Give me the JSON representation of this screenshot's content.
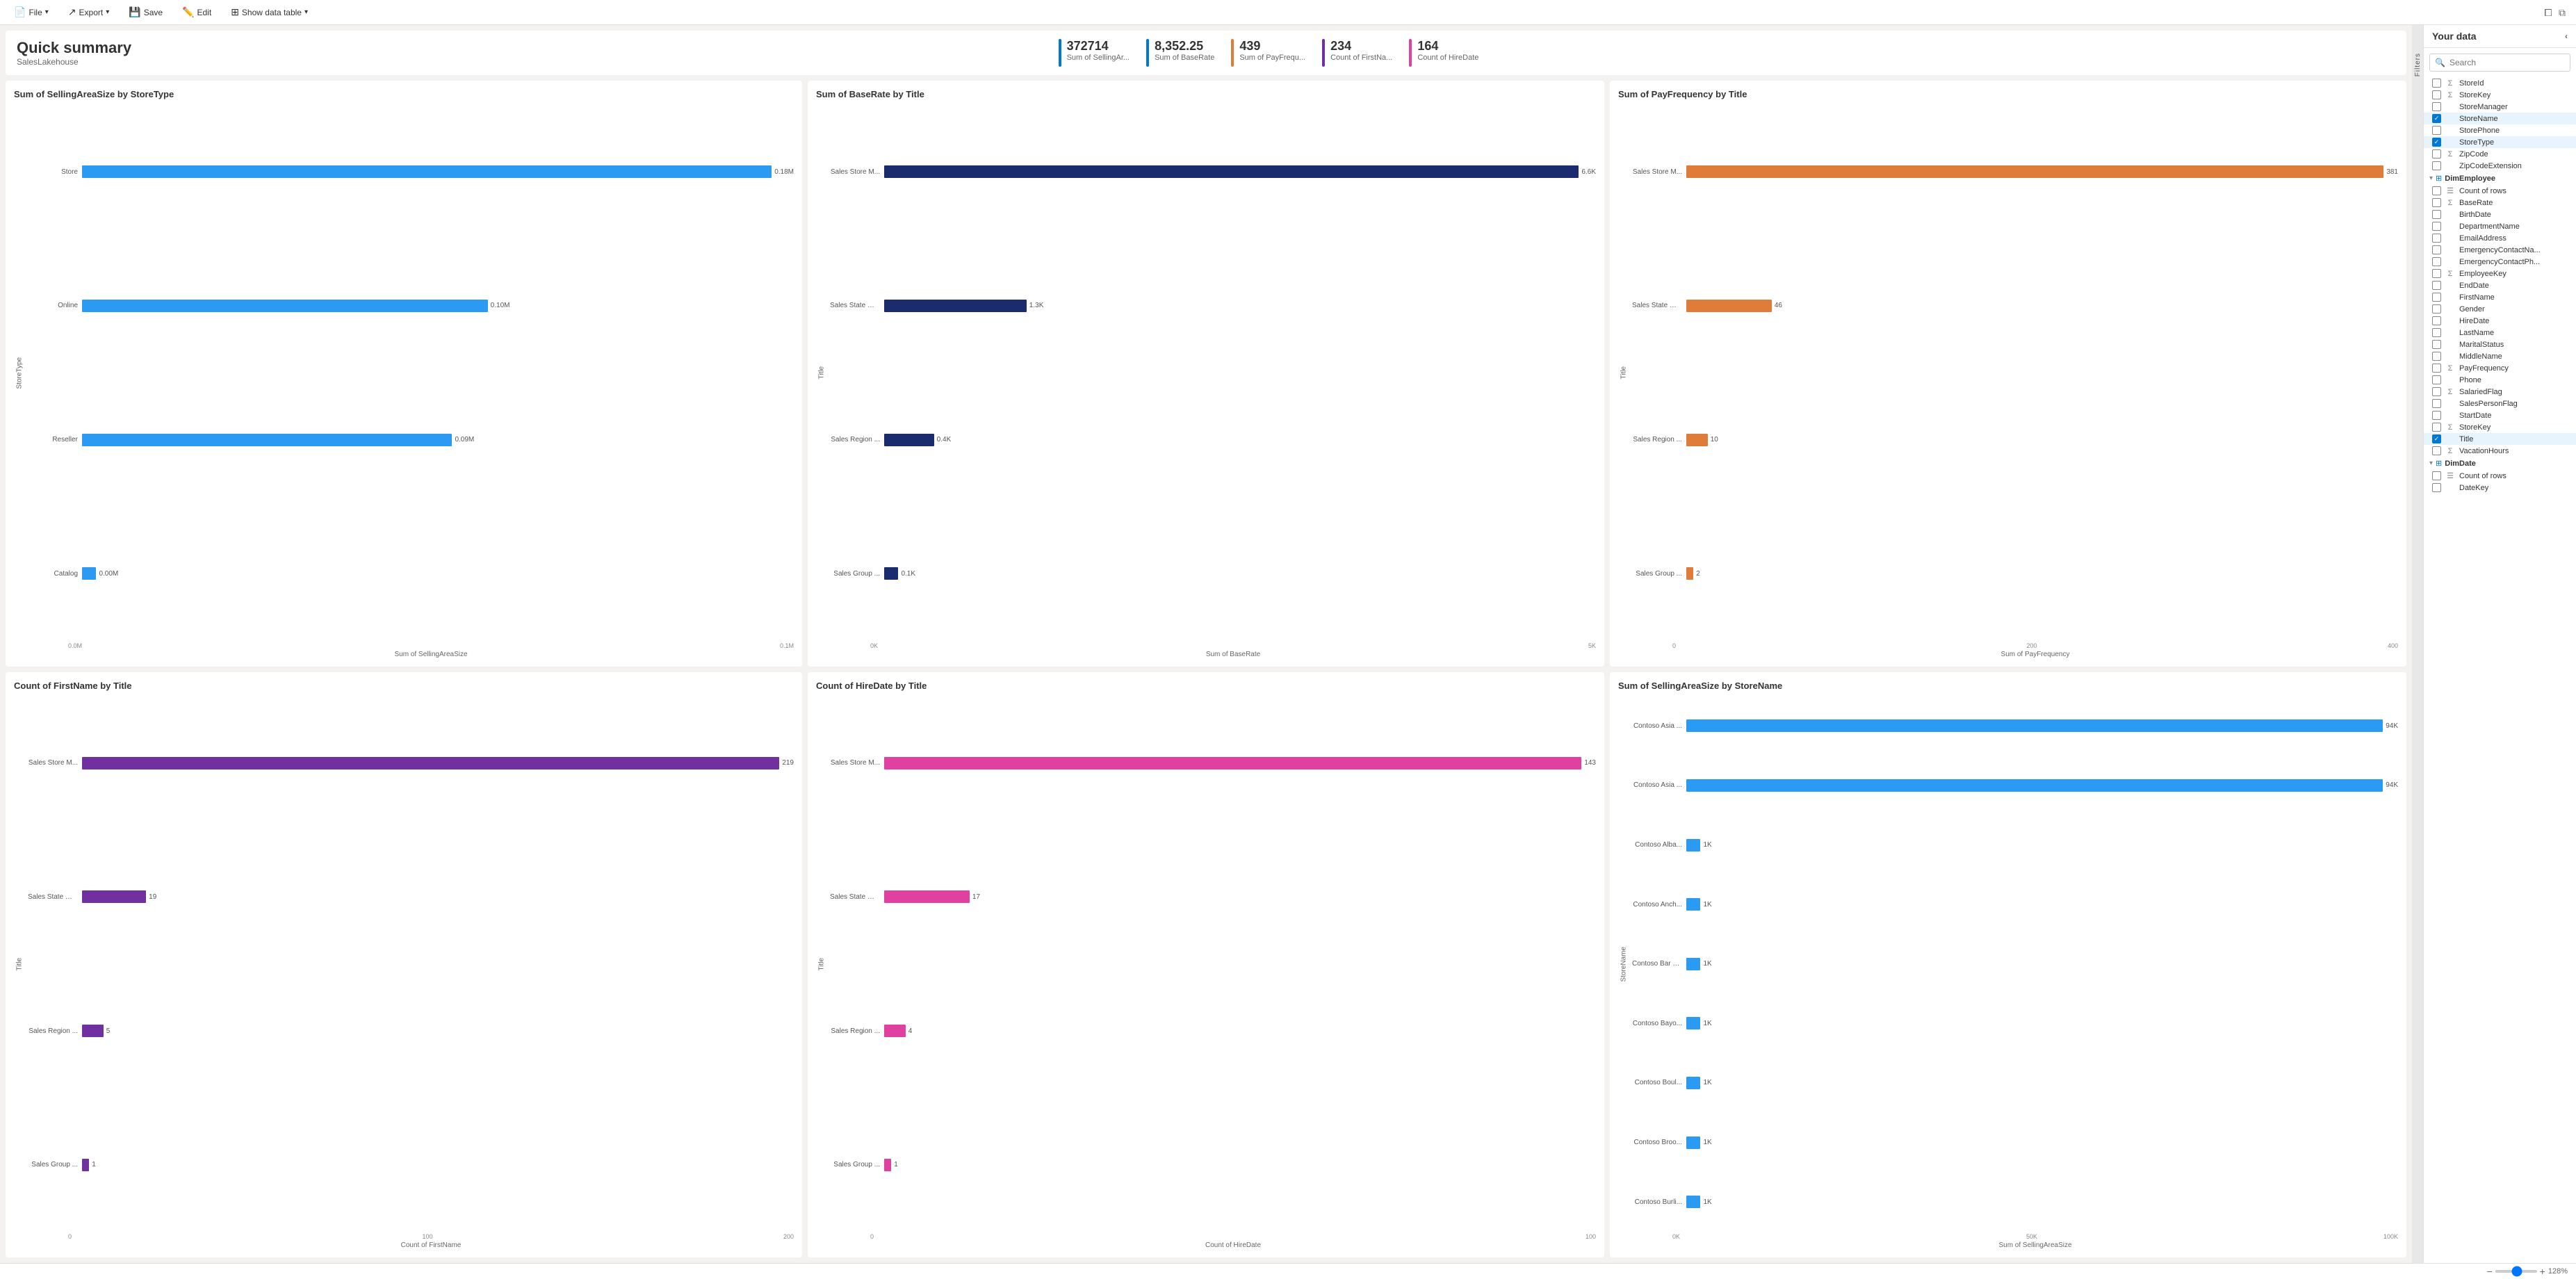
{
  "topbar": {
    "file_label": "File",
    "export_label": "Export",
    "save_label": "Save",
    "edit_label": "Edit",
    "show_data_table_label": "Show data table"
  },
  "header": {
    "title": "Quick summary",
    "subtitle": "SalesLakehouse",
    "kpis": [
      {
        "value": "372714",
        "label": "Sum of SellingAr...",
        "color": "#0078d4"
      },
      {
        "value": "8,352.25",
        "label": "Sum of BaseRate",
        "color": "#0078d4"
      },
      {
        "value": "439",
        "label": "Sum of PayFrequ...",
        "color": "#e07c39"
      },
      {
        "value": "234",
        "label": "Count of FirstNa...",
        "color": "#7030a0"
      },
      {
        "value": "164",
        "label": "Count of HireDate",
        "color": "#e040a0"
      }
    ]
  },
  "charts": [
    {
      "id": "chart1",
      "title": "Sum of SellingAreaSize by StoreType",
      "y_axis_label": "StoreType",
      "x_axis_label": "Sum of SellingAreaSize",
      "bar_color": "#2b9af3",
      "x_ticks": [
        "0.0M",
        "0.1M"
      ],
      "bars": [
        {
          "label": "Store",
          "value": "0.18M",
          "pct": 100
        },
        {
          "label": "Online",
          "value": "0.10M",
          "pct": 57
        },
        {
          "label": "Reseller",
          "value": "0.09M",
          "pct": 52
        },
        {
          "label": "Catalog",
          "value": "0.00M",
          "pct": 2
        }
      ]
    },
    {
      "id": "chart2",
      "title": "Sum of BaseRate by Title",
      "y_axis_label": "Title",
      "x_axis_label": "Sum of BaseRate",
      "bar_color": "#1a2c6e",
      "x_ticks": [
        "0K",
        "5K"
      ],
      "bars": [
        {
          "label": "Sales Store M...",
          "value": "6.6K",
          "pct": 100
        },
        {
          "label": "Sales State Ma...",
          "value": "1.3K",
          "pct": 20
        },
        {
          "label": "Sales Region ...",
          "value": "0.4K",
          "pct": 7
        },
        {
          "label": "Sales Group ...",
          "value": "0.1K",
          "pct": 2
        }
      ]
    },
    {
      "id": "chart3",
      "title": "Sum of PayFrequency by Title",
      "y_axis_label": "Title",
      "x_axis_label": "Sum of PayFrequency",
      "bar_color": "#e07c39",
      "x_ticks": [
        "0",
        "200",
        "400"
      ],
      "bars": [
        {
          "label": "Sales Store M...",
          "value": "381",
          "pct": 100
        },
        {
          "label": "Sales State Ma...",
          "value": "46",
          "pct": 12
        },
        {
          "label": "Sales Region ...",
          "value": "10",
          "pct": 3
        },
        {
          "label": "Sales Group ...",
          "value": "2",
          "pct": 1
        }
      ]
    },
    {
      "id": "chart4",
      "title": "Count of FirstName by Title",
      "y_axis_label": "Title",
      "x_axis_label": "Count of FirstName",
      "bar_color": "#7030a0",
      "x_ticks": [
        "0",
        "100",
        "200"
      ],
      "bars": [
        {
          "label": "Sales Store M...",
          "value": "219",
          "pct": 100
        },
        {
          "label": "Sales State Ma...",
          "value": "19",
          "pct": 9
        },
        {
          "label": "Sales Region ...",
          "value": "5",
          "pct": 3
        },
        {
          "label": "Sales Group ...",
          "value": "1",
          "pct": 1
        }
      ]
    },
    {
      "id": "chart5",
      "title": "Count of HireDate by Title",
      "y_axis_label": "Title",
      "x_axis_label": "Count of HireDate",
      "bar_color": "#e040a0",
      "x_ticks": [
        "0",
        "100"
      ],
      "bars": [
        {
          "label": "Sales Store M...",
          "value": "143",
          "pct": 100
        },
        {
          "label": "Sales State Ma...",
          "value": "17",
          "pct": 12
        },
        {
          "label": "Sales Region ...",
          "value": "4",
          "pct": 3
        },
        {
          "label": "Sales Group ...",
          "value": "1",
          "pct": 1
        }
      ]
    },
    {
      "id": "chart6",
      "title": "Sum of SellingAreaSize by StoreName",
      "y_axis_label": "StoreName",
      "x_axis_label": "Sum of SellingAreaSize",
      "bar_color": "#2b9af3",
      "x_ticks": [
        "0K",
        "50K",
        "100K"
      ],
      "bars": [
        {
          "label": "Contoso Asia ...",
          "value": "94K",
          "pct": 100
        },
        {
          "label": "Contoso Asia ...",
          "value": "94K",
          "pct": 100
        },
        {
          "label": "Contoso Alba...",
          "value": "1K",
          "pct": 2
        },
        {
          "label": "Contoso Anch...",
          "value": "1K",
          "pct": 2
        },
        {
          "label": "Contoso Bar H...",
          "value": "1K",
          "pct": 2
        },
        {
          "label": "Contoso Bayo...",
          "value": "1K",
          "pct": 2
        },
        {
          "label": "Contoso Boul...",
          "value": "1K",
          "pct": 2
        },
        {
          "label": "Contoso Broo...",
          "value": "1K",
          "pct": 2
        },
        {
          "label": "Contoso Burli...",
          "value": "1K",
          "pct": 2
        }
      ]
    }
  ],
  "sidebar": {
    "header_title": "Your data",
    "search_placeholder": "Search",
    "filters_label": "Filters",
    "items": [
      {
        "type": "item",
        "label": "StoreId",
        "icon": "Σ",
        "checked": false,
        "highlighted": false
      },
      {
        "type": "item",
        "label": "StoreKey",
        "icon": "Σ",
        "checked": false,
        "highlighted": false
      },
      {
        "type": "item",
        "label": "StoreManager",
        "icon": "",
        "checked": false,
        "highlighted": false
      },
      {
        "type": "item",
        "label": "StoreName",
        "icon": "",
        "checked": true,
        "highlighted": true
      },
      {
        "type": "item",
        "label": "StorePhone",
        "icon": "",
        "checked": false,
        "highlighted": false
      },
      {
        "type": "item",
        "label": "StoreType",
        "icon": "",
        "checked": true,
        "highlighted": true
      },
      {
        "type": "item",
        "label": "ZipCode",
        "icon": "Σ",
        "checked": false,
        "highlighted": false
      },
      {
        "type": "item",
        "label": "ZipCodeExtension",
        "icon": "",
        "checked": false,
        "highlighted": false
      },
      {
        "type": "group",
        "label": "DimEmployee",
        "expanded": true
      },
      {
        "type": "item",
        "label": "Count of rows",
        "icon": "☰",
        "checked": false,
        "highlighted": false
      },
      {
        "type": "item",
        "label": "BaseRate",
        "icon": "Σ",
        "checked": false,
        "highlighted": false
      },
      {
        "type": "item",
        "label": "BirthDate",
        "icon": "",
        "checked": false,
        "highlighted": false
      },
      {
        "type": "item",
        "label": "DepartmentName",
        "icon": "",
        "checked": false,
        "highlighted": false
      },
      {
        "type": "item",
        "label": "EmailAddress",
        "icon": "",
        "checked": false,
        "highlighted": false
      },
      {
        "type": "item",
        "label": "EmergencyContactNa...",
        "icon": "",
        "checked": false,
        "highlighted": false
      },
      {
        "type": "item",
        "label": "EmergencyContactPh...",
        "icon": "",
        "checked": false,
        "highlighted": false
      },
      {
        "type": "item",
        "label": "EmployeeKey",
        "icon": "Σ",
        "checked": false,
        "highlighted": false
      },
      {
        "type": "item",
        "label": "EndDate",
        "icon": "",
        "checked": false,
        "highlighted": false
      },
      {
        "type": "item",
        "label": "FirstName",
        "icon": "",
        "checked": false,
        "highlighted": false
      },
      {
        "type": "item",
        "label": "Gender",
        "icon": "",
        "checked": false,
        "highlighted": false
      },
      {
        "type": "item",
        "label": "HireDate",
        "icon": "",
        "checked": false,
        "highlighted": false
      },
      {
        "type": "item",
        "label": "LastName",
        "icon": "",
        "checked": false,
        "highlighted": false
      },
      {
        "type": "item",
        "label": "MaritalStatus",
        "icon": "",
        "checked": false,
        "highlighted": false
      },
      {
        "type": "item",
        "label": "MiddleName",
        "icon": "",
        "checked": false,
        "highlighted": false
      },
      {
        "type": "item",
        "label": "PayFrequency",
        "icon": "Σ",
        "checked": false,
        "highlighted": false
      },
      {
        "type": "item",
        "label": "Phone",
        "icon": "",
        "checked": false,
        "highlighted": false
      },
      {
        "type": "item",
        "label": "SalariedFlag",
        "icon": "Σ",
        "checked": false,
        "highlighted": false
      },
      {
        "type": "item",
        "label": "SalesPersonFlag",
        "icon": "",
        "checked": false,
        "highlighted": false
      },
      {
        "type": "item",
        "label": "StartDate",
        "icon": "",
        "checked": false,
        "highlighted": false
      },
      {
        "type": "item",
        "label": "StoreKey",
        "icon": "Σ",
        "checked": false,
        "highlighted": false
      },
      {
        "type": "item",
        "label": "Title",
        "icon": "",
        "checked": true,
        "highlighted": true
      },
      {
        "type": "item",
        "label": "VacationHours",
        "icon": "Σ",
        "checked": false,
        "highlighted": false
      },
      {
        "type": "group",
        "label": "DimDate",
        "expanded": true
      },
      {
        "type": "item",
        "label": "Count of rows",
        "icon": "☰",
        "checked": false,
        "highlighted": false
      },
      {
        "type": "item",
        "label": "DateKey",
        "icon": "",
        "checked": false,
        "highlighted": false
      }
    ]
  },
  "bottombar": {
    "zoom_level": "128%",
    "zoom_minus": "−",
    "zoom_plus": "+"
  }
}
